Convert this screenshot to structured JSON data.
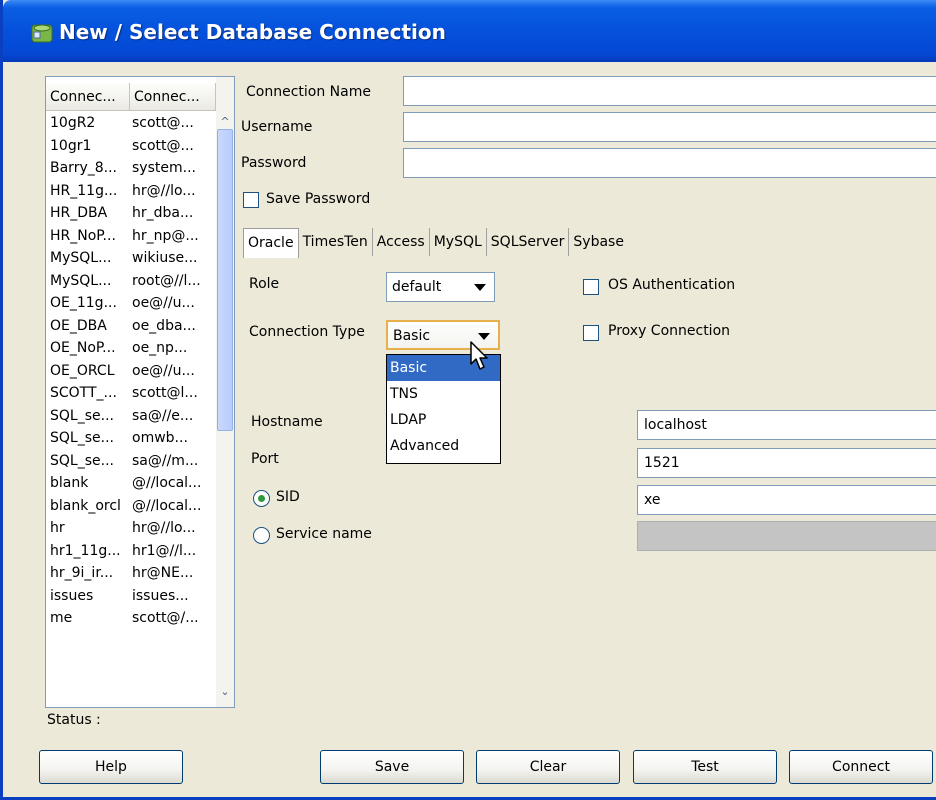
{
  "window": {
    "title": "New / Select Database Connection"
  },
  "connections": {
    "columns": [
      "Connec...",
      "Connec..."
    ],
    "rows": [
      [
        "10gR2",
        "scott@..."
      ],
      [
        "10gr1",
        "scott@..."
      ],
      [
        "Barry_8...",
        "system..."
      ],
      [
        "HR_11g...",
        "hr@//lo..."
      ],
      [
        "HR_DBA",
        "hr_dba..."
      ],
      [
        "HR_NoP...",
        "hr_np@..."
      ],
      [
        "MySQL...",
        "wikiuse..."
      ],
      [
        "MySQL...",
        "root@//l..."
      ],
      [
        "OE_11g...",
        "oe@//u..."
      ],
      [
        "OE_DBA",
        "oe_dba..."
      ],
      [
        "OE_NoP...",
        "oe_np..."
      ],
      [
        "OE_ORCL",
        "oe@//u..."
      ],
      [
        "SCOTT_...",
        "scott@l..."
      ],
      [
        "SQL_se...",
        "sa@//e..."
      ],
      [
        "SQL_se...",
        "omwb..."
      ],
      [
        "SQL_se...",
        "sa@//m..."
      ],
      [
        "blank",
        "@//local..."
      ],
      [
        "blank_orcl",
        "@//local..."
      ],
      [
        "hr",
        "hr@//lo..."
      ],
      [
        "hr1_11g...",
        "hr1@//l..."
      ],
      [
        "hr_9i_ir...",
        "hr@NE..."
      ],
      [
        "issues",
        "issues..."
      ],
      [
        "me",
        "scott@/..."
      ]
    ]
  },
  "status_label": "Status :",
  "form": {
    "connection_name_label": "Connection Name",
    "connection_name_value": "",
    "username_label": "Username",
    "username_value": "",
    "password_label": "Password",
    "password_value": "",
    "save_password_label": "Save Password",
    "save_password_checked": false
  },
  "tabs": [
    "Oracle",
    "TimesTen",
    "Access",
    "MySQL",
    "SQLServer",
    "Sybase"
  ],
  "active_tab": "Oracle",
  "oracle": {
    "role_label": "Role",
    "role_value": "default",
    "os_auth_label": "OS Authentication",
    "conn_type_label": "Connection Type",
    "conn_type_value": "Basic",
    "proxy_label": "Proxy Connection",
    "conn_type_options": [
      "Basic",
      "TNS",
      "LDAP",
      "Advanced"
    ],
    "conn_type_selected": "Basic",
    "hostname_label": "Hostname",
    "hostname_value": "localhost",
    "port_label": "Port",
    "port_value": "1521",
    "sid_label": "SID",
    "sid_value": "xe",
    "sid_selected": true,
    "service_name_label": "Service name",
    "service_name_value": ""
  },
  "buttons": {
    "help": "Help",
    "save": "Save",
    "clear": "Clear",
    "test": "Test",
    "connect": "Connect"
  },
  "colors": {
    "title_bar": "#0551dc",
    "dialog_bg": "#ece9d8",
    "selection": "#316ac5",
    "focus_border": "#e8b04c"
  },
  "icons": {
    "title": "database-connection-icon",
    "dropdown": "chevron-down-icon",
    "scroll_up": "scroll-up-arrow-icon",
    "scroll_down": "scroll-down-arrow-icon",
    "cursor": "mouse-pointer-icon"
  }
}
